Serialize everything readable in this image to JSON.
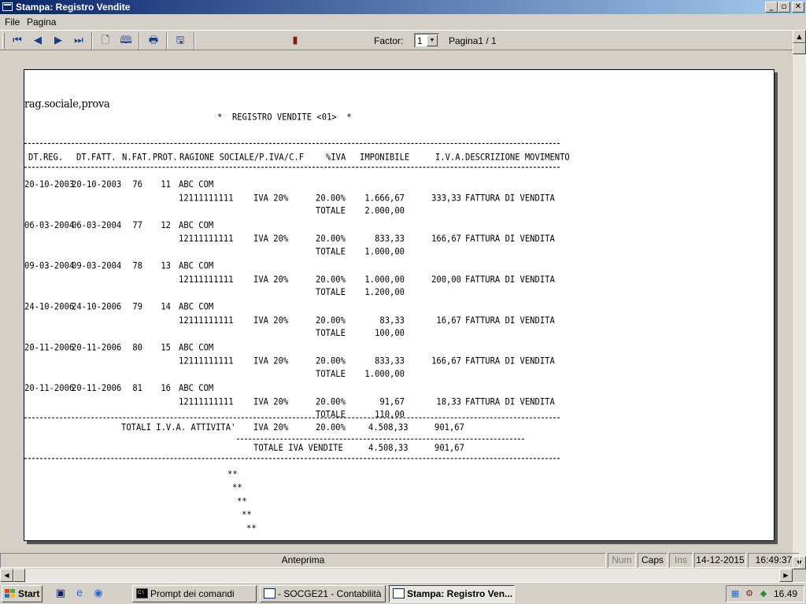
{
  "window": {
    "title": "Stampa: Registro Vendite",
    "min_glyph": "_",
    "max_glyph": "▫",
    "close_glyph": "✕"
  },
  "menu": {
    "file": "File",
    "pagina": "Pagina"
  },
  "toolbar": {
    "factor_label": "Factor:",
    "factor_value": "1",
    "page_label": "Pagina1 / 1",
    "icons": {
      "first": "⏮",
      "prev": "◀",
      "next": "▶",
      "last": "⏭",
      "single_page": "🗋",
      "two_pages": "🕮",
      "print": "🖶",
      "export": "🖫",
      "exit": "▮"
    }
  },
  "report": {
    "company": "rag.sociale,prova",
    "title": "*  REGISTRO VENDITE <01>  *",
    "headers": {
      "dt_reg": "DT.REG.",
      "dt_fatt": "DT.FATT.",
      "n_fat": "N.FAT.",
      "prot": "PROT.",
      "ragione": "RAGIONE SOCIALE/P.IVA/C.F",
      "piva": "%IVA",
      "imponibile": "IMPONIBILE",
      "iva": "I.V.A.",
      "descrizione": "DESCRIZIONE MOVIMENTO"
    },
    "rows": [
      {
        "dt_reg": "20-10-2003",
        "dt_fatt": "20-10-2003",
        "n_fat": "76",
        "prot": "11",
        "name": "ABC COM",
        "piva_cf": "12111111111",
        "cod_iva": "IVA 20%",
        "perc": "20.00%",
        "imponibile": "1.666,67",
        "iva": "333,33",
        "descr": "FATTURA DI VENDITA",
        "totale_label": "TOTALE",
        "totale": "2.000,00"
      },
      {
        "dt_reg": "06-03-2004",
        "dt_fatt": "06-03-2004",
        "n_fat": "77",
        "prot": "12",
        "name": "ABC COM",
        "piva_cf": "12111111111",
        "cod_iva": "IVA 20%",
        "perc": "20.00%",
        "imponibile": "833,33",
        "iva": "166,67",
        "descr": "FATTURA DI VENDITA",
        "totale_label": "TOTALE",
        "totale": "1.000,00"
      },
      {
        "dt_reg": "09-03-2004",
        "dt_fatt": "09-03-2004",
        "n_fat": "78",
        "prot": "13",
        "name": "ABC COM",
        "piva_cf": "12111111111",
        "cod_iva": "IVA 20%",
        "perc": "20.00%",
        "imponibile": "1.000,00",
        "iva": "200,00",
        "descr": "FATTURA DI VENDITA",
        "totale_label": "TOTALE",
        "totale": "1.200,00"
      },
      {
        "dt_reg": "24-10-2006",
        "dt_fatt": "24-10-2006",
        "n_fat": "79",
        "prot": "14",
        "name": "ABC COM",
        "piva_cf": "12111111111",
        "cod_iva": "IVA 20%",
        "perc": "20.00%",
        "imponibile": "83,33",
        "iva": "16,67",
        "descr": "FATTURA DI VENDITA",
        "totale_label": "TOTALE",
        "totale": "100,00"
      },
      {
        "dt_reg": "20-11-2006",
        "dt_fatt": "20-11-2006",
        "n_fat": "80",
        "prot": "15",
        "name": "ABC COM",
        "piva_cf": "12111111111",
        "cod_iva": "IVA 20%",
        "perc": "20.00%",
        "imponibile": "833,33",
        "iva": "166,67",
        "descr": "FATTURA DI VENDITA",
        "totale_label": "TOTALE",
        "totale": "1.000,00"
      },
      {
        "dt_reg": "20-11-2006",
        "dt_fatt": "20-11-2006",
        "n_fat": "81",
        "prot": "16",
        "name": "ABC COM",
        "piva_cf": "12111111111",
        "cod_iva": "IVA 20%",
        "perc": "20.00%",
        "imponibile": "91,67",
        "iva": "18,33",
        "descr": "FATTURA DI VENDITA",
        "totale_label": "TOTALE",
        "totale": "110,00"
      }
    ],
    "totals": {
      "label": "TOTALI I.V.A. ATTIVITA'",
      "cod_iva": "IVA 20%",
      "perc": "20.00%",
      "imponibile": "4.508,33",
      "iva": "901,67",
      "vendite_label": "TOTALE IVA VENDITE",
      "vendite_imponibile": "4.508,33",
      "vendite_iva": "901,67"
    },
    "stars": [
      "**",
      "**",
      "**",
      "**",
      "**"
    ]
  },
  "statusbar": {
    "mode": "Anteprima",
    "num": "Num",
    "caps": "Caps",
    "ins": "Ins",
    "date": "14-12-2015",
    "time": "16:49:37"
  },
  "taskbar": {
    "start": "Start",
    "tasks": [
      {
        "label": "Prompt dei comandi",
        "active": false
      },
      {
        "label": "- SOCGE21 - Contabilità ...",
        "active": false
      },
      {
        "label": "Stampa: Registro Ven...",
        "active": true
      }
    ],
    "clock": "16.49"
  }
}
